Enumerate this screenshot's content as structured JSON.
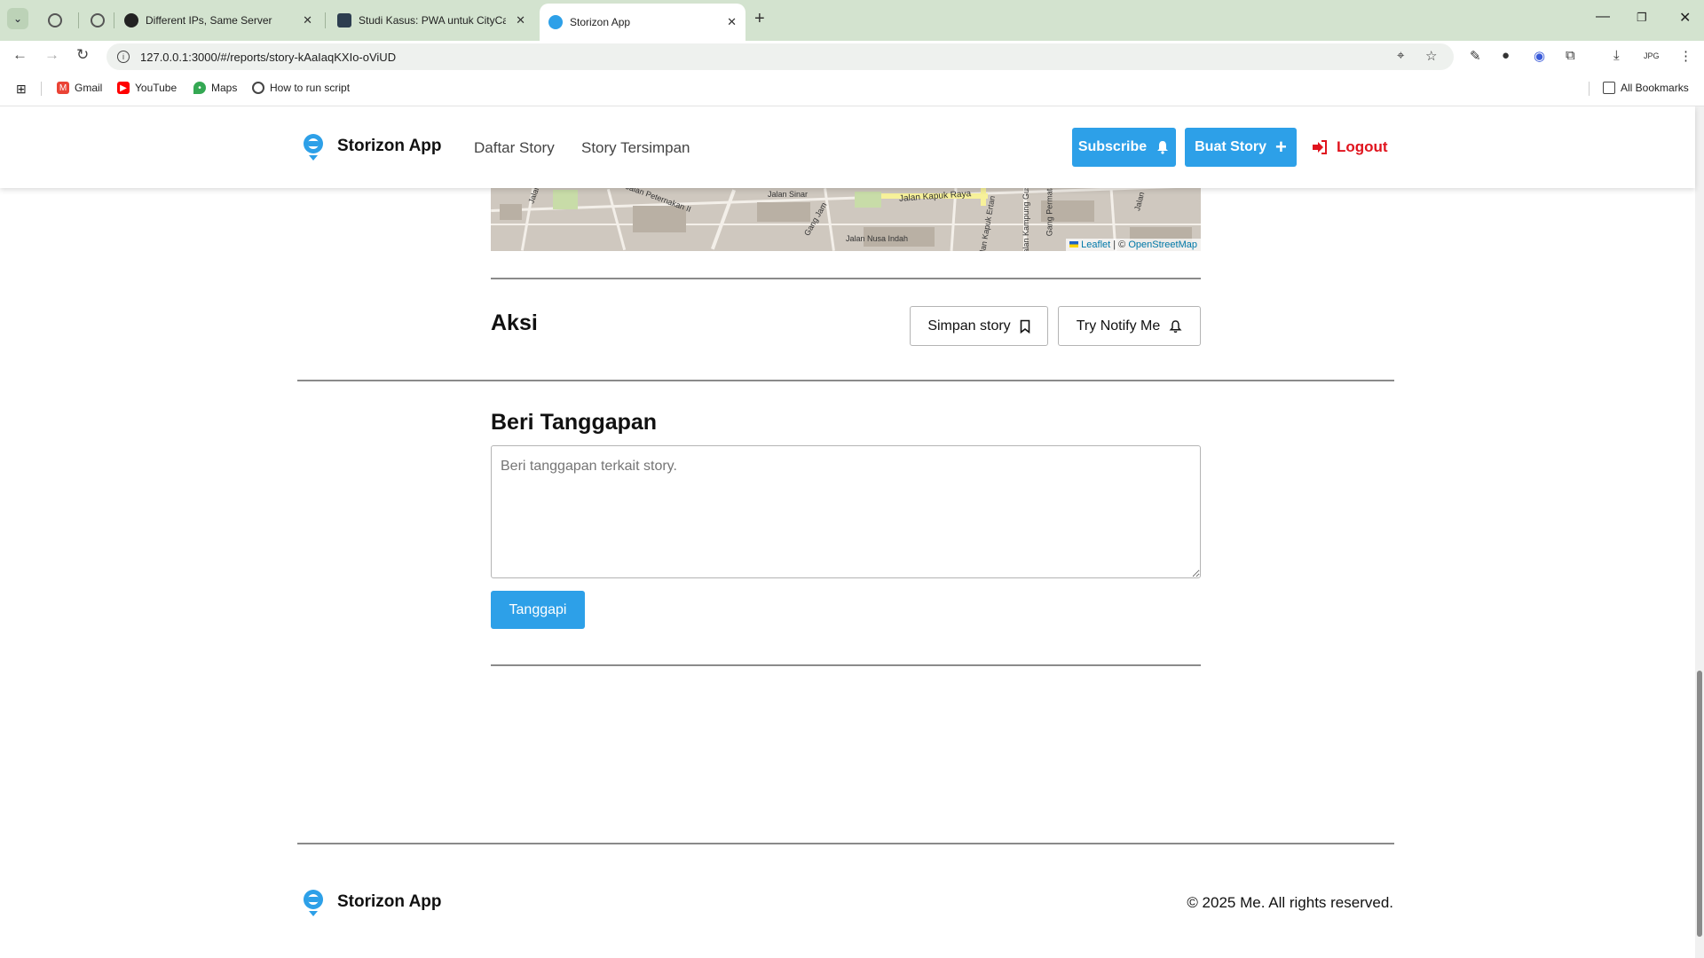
{
  "browser": {
    "tabs": [
      {
        "title": "",
        "icon": "globe-icon"
      },
      {
        "title": "",
        "icon": "globe-icon"
      },
      {
        "title": "Different IPs, Same Server",
        "icon": "chatgpt-icon"
      },
      {
        "title": "Studi Kasus: PWA untuk CityCar",
        "icon": "dicoding-icon"
      },
      {
        "title": "Storizon App",
        "icon": "storizon-icon"
      }
    ],
    "url": "127.0.0.1:3000/#/reports/story-kAaIaqKXIo-oViUD",
    "bookmarks": [
      {
        "label": "Gmail",
        "icon": "gmail-icon"
      },
      {
        "label": "YouTube",
        "icon": "youtube-icon"
      },
      {
        "label": "Maps",
        "icon": "maps-icon"
      },
      {
        "label": "How to run script",
        "icon": "globe-icon"
      }
    ],
    "all_bookmarks": "All Bookmarks",
    "extension_label": "JPG"
  },
  "header": {
    "brand": "Storizon App",
    "nav": [
      "Daftar Story",
      "Story Tersimpan"
    ],
    "subscribe": "Subscribe",
    "create_story": "Buat Story",
    "logout": "Logout"
  },
  "map": {
    "labels": [
      "Jalan",
      "Jalan Peternakan II",
      "Jalan Sinar",
      "Jalan Kapuk Raya",
      "Jalan Nusa Indah",
      "Gang Jam",
      "Jalan Kampung Gusti",
      "Jalan Kapuk Ertan",
      "Gang Permata",
      "Jalan"
    ],
    "attribution_leaflet": "Leaflet",
    "attribution_sep": " | © ",
    "attribution_osm": "OpenStreetMap"
  },
  "actions": {
    "title": "Aksi",
    "save": "Simpan story",
    "notify": "Try Notify Me"
  },
  "comment": {
    "title": "Beri Tanggapan",
    "placeholder": "Beri tanggapan terkait story.",
    "submit": "Tanggapi"
  },
  "footer": {
    "brand": "Storizon App",
    "copyright": "© 2025 Me. All rights reserved."
  },
  "colors": {
    "primary": "#2da0e8",
    "logout": "#e0141e",
    "chrome": "#d3e3cf"
  }
}
